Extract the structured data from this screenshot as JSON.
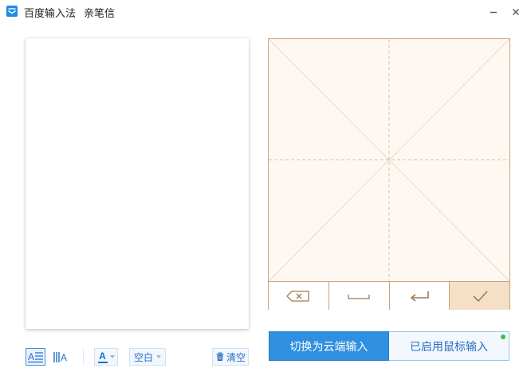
{
  "window": {
    "app_name": "百度输入法",
    "tool_name": "亲笔信",
    "minimize_icon": "minimize-icon",
    "close_icon": "close-icon"
  },
  "writing_pad": {
    "toolbar": {
      "backspace_icon": "backspace-icon",
      "space_icon": "space-icon",
      "enter_icon": "enter-icon",
      "confirm_icon": "checkmark-icon"
    }
  },
  "actions": {
    "cloud_input_label": "切换为云端输入",
    "mouse_input_label": "已启用鼠标输入"
  },
  "bottom_toolbar": {
    "layout_horizontal_icon": "horizontal-layout-icon",
    "layout_vertical_icon": "vertical-layout-icon",
    "font_color_letter": "A",
    "background_label": "空白",
    "clear_label": "清空",
    "clear_icon": "trash-icon"
  },
  "colors": {
    "accent_blue": "#2f8fe0",
    "pad_border": "#c8a27a",
    "pad_background": "#fdf9f2",
    "confirm_background": "#f5dfc5",
    "status_green": "#35c437"
  }
}
